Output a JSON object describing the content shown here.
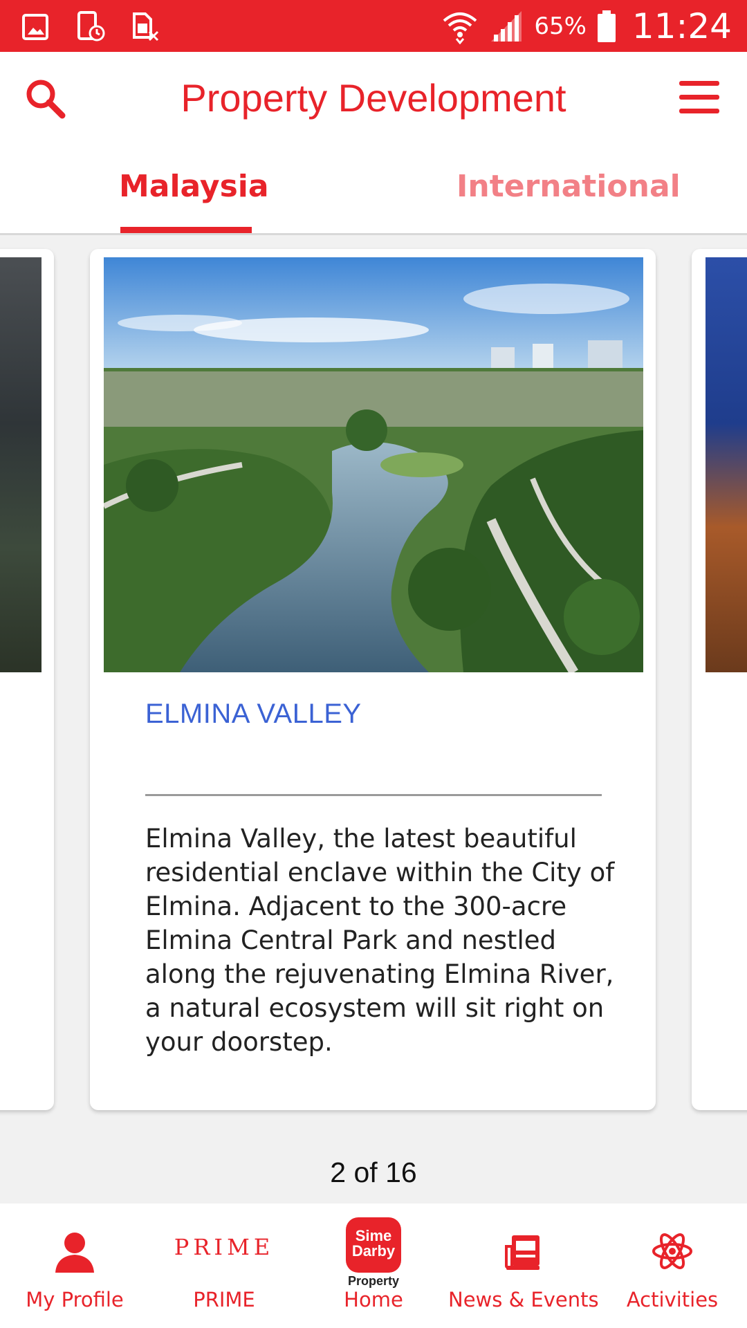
{
  "status_bar": {
    "battery_percent": "65%",
    "time": "11:24",
    "icons": [
      "image-icon",
      "device-clock-icon",
      "sim-off-icon",
      "wifi-icon",
      "signal-icon",
      "battery-icon"
    ]
  },
  "header": {
    "title": "Property Development",
    "search_icon": "search-icon",
    "menu_icon": "menu-icon"
  },
  "tabs": [
    {
      "label": "Malaysia",
      "active": true
    },
    {
      "label": "International",
      "active": false
    }
  ],
  "carousel": {
    "current_card": {
      "title": "ELMINA VALLEY",
      "description": "Elmina Valley, the latest beautiful residential enclave within the City of Elmina. Adjacent to the 300-acre Elmina Central Park and nestled along the rejuvenating Elmina River, a natural ecosystem will sit right on your doorstep."
    },
    "pager": "2 of 16"
  },
  "bottom_nav": {
    "items": [
      {
        "label": "My Profile",
        "icon": "person-icon"
      },
      {
        "label": "PRIME",
        "icon": "prime-logo",
        "logo_text": "PRIME"
      },
      {
        "label": "Home",
        "icon": "sime-darby-logo",
        "logo_text": "Sime Darby",
        "logo_sub": "Property"
      },
      {
        "label": "News & Events",
        "icon": "newspaper-icon"
      },
      {
        "label": "Activities",
        "icon": "atom-icon"
      }
    ]
  },
  "colors": {
    "brand_red": "#e8232a",
    "title_blue": "#3b62d4",
    "inactive_tab": "#f28086"
  }
}
